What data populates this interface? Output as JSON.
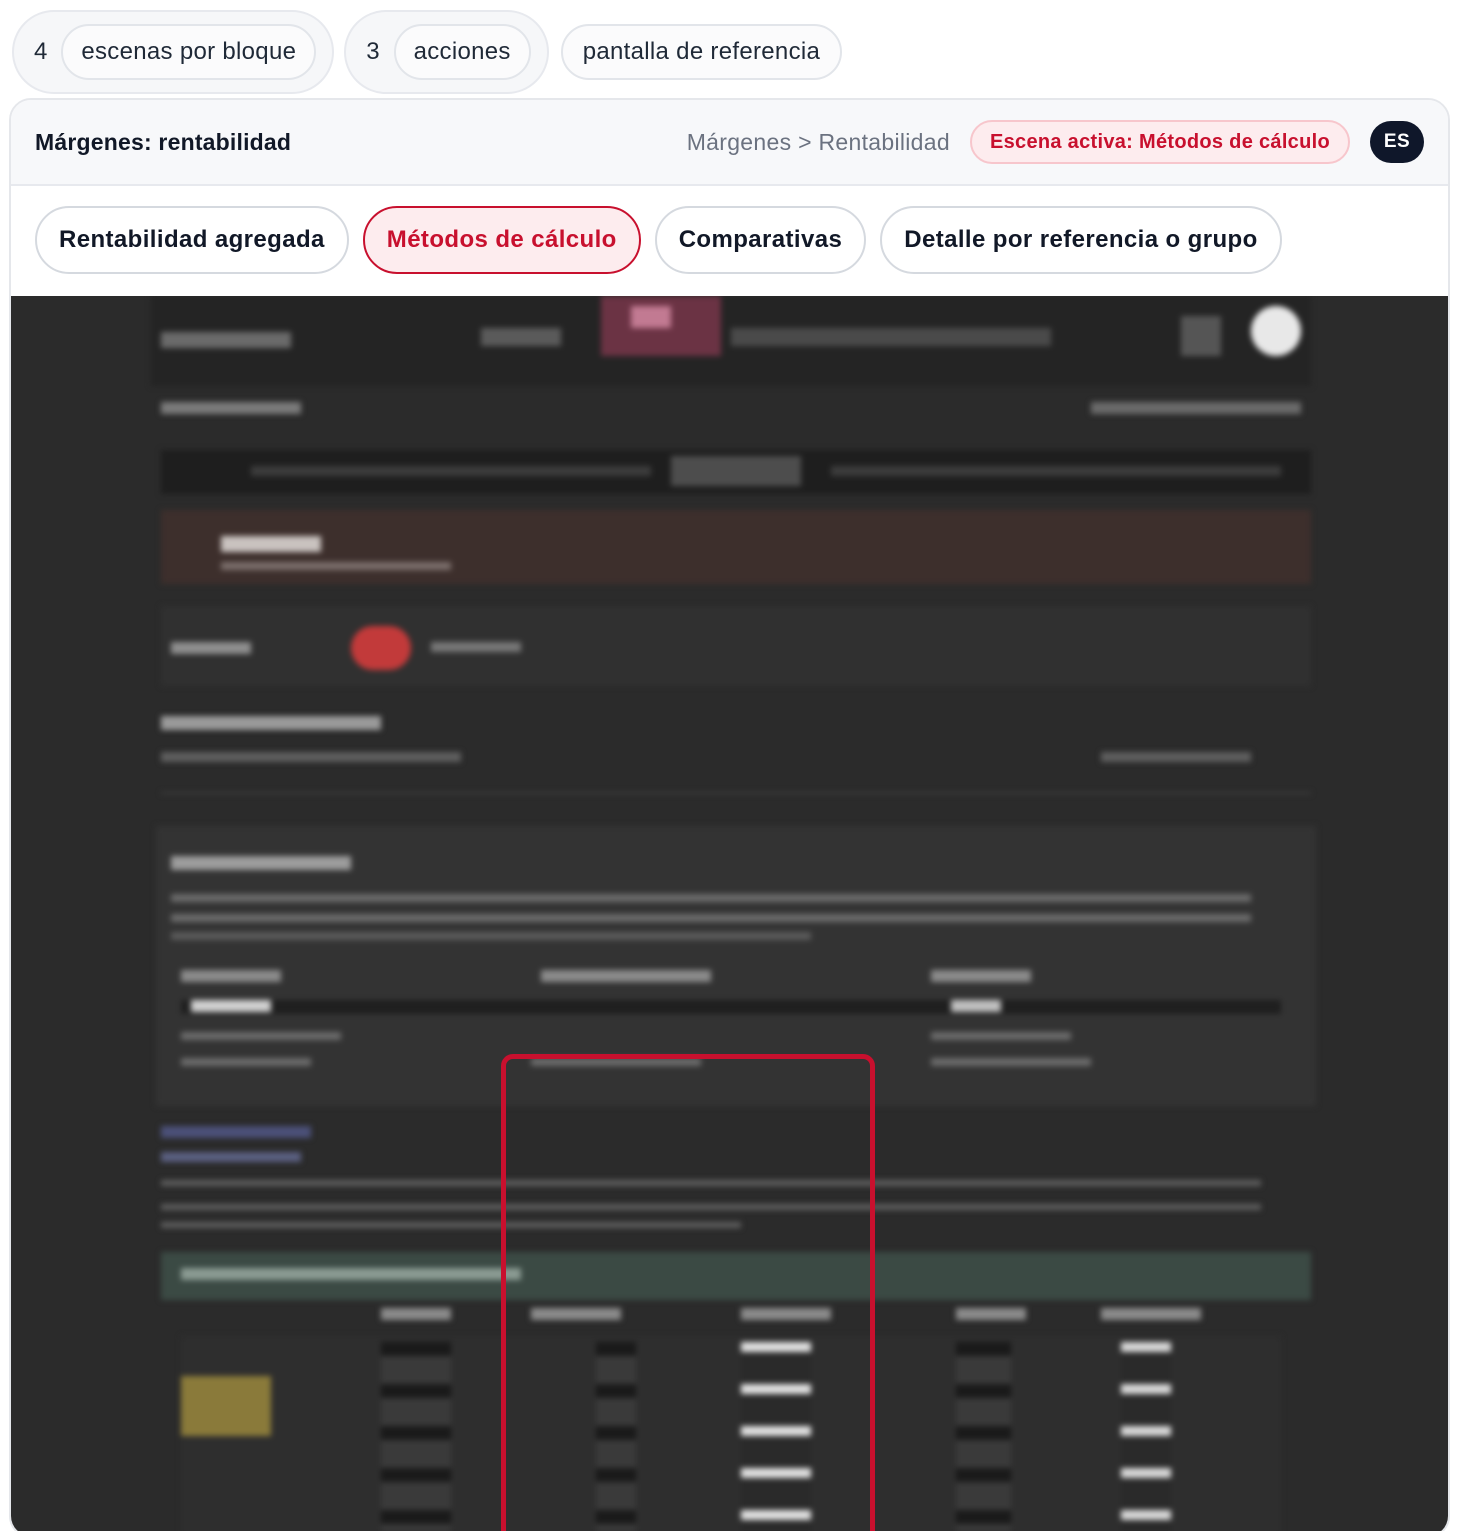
{
  "pills": {
    "scenes": {
      "count": "4",
      "label": "escenas por bloque"
    },
    "actions": {
      "count": "3",
      "label": "acciones"
    },
    "reference": {
      "label": "pantalla de referencia"
    }
  },
  "header": {
    "title": "Márgenes: rentabilidad",
    "breadcrumb": "Márgenes > Rentabilidad",
    "active_scene": "Escena activa: Métodos de cálculo",
    "language": "ES"
  },
  "tabs": [
    {
      "label": "Rentabilidad agregada",
      "active": false
    },
    {
      "label": "Métodos de cálculo",
      "active": true
    },
    {
      "label": "Comparativas",
      "active": false
    },
    {
      "label": "Detalle por referencia o grupo",
      "active": false
    }
  ],
  "colors": {
    "accent": "#c8102e",
    "dark": "#0f172a",
    "screenshot_bg": "#2b2b2b"
  }
}
